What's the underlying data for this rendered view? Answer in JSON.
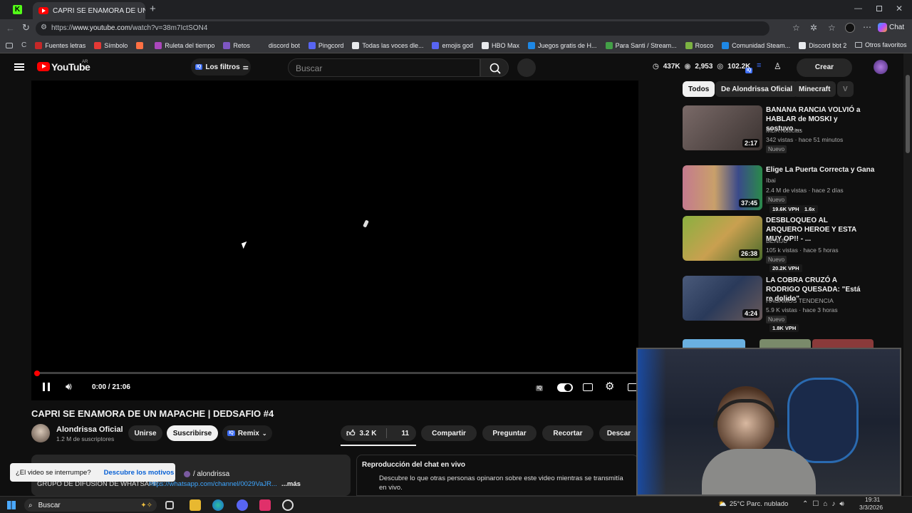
{
  "browser": {
    "tab_title": "CAPRI SE ENAMORA DE UN MAPACHE",
    "url_prefix": "https://",
    "url_host": "www.youtube.com",
    "url_path": "/watch?v=38m7IctSON4",
    "chat_label": "Chat",
    "bookmarks": [
      {
        "label": "Fuentes letras",
        "color": "#c62828"
      },
      {
        "label": "Símbolo",
        "color": "#e53935"
      },
      {
        "label": "",
        "color": "#ff7043"
      },
      {
        "label": "Ruleta del tiempo",
        "color": "#ab47bc"
      },
      {
        "label": "Retos",
        "color": "#7e57c2"
      },
      {
        "label": "discord bot",
        "color": "#35363a"
      },
      {
        "label": "Pingcord",
        "color": "#5865f2"
      },
      {
        "label": "Todas las voces dle...",
        "color": "#e8eaed"
      },
      {
        "label": "emojis god",
        "color": "#5865f2"
      },
      {
        "label": "HBO Max",
        "color": "#e8eaed"
      },
      {
        "label": "Juegos gratis de H...",
        "color": "#1e88e5"
      },
      {
        "label": "Para Santi / Stream...",
        "color": "#43a047"
      },
      {
        "label": "Rosco",
        "color": "#7cb342"
      },
      {
        "label": "Comunidad Steam...",
        "color": "#1e88e5"
      },
      {
        "label": "Discord bot 2",
        "color": "#e8eaed"
      }
    ],
    "other_favorites": "Otros favoritos"
  },
  "youtube": {
    "logo_text": "YouTube",
    "country": "AR",
    "filters_label": "Los filtros",
    "search_placeholder": "Buscar",
    "stats": [
      "437K",
      "2,953",
      "102.2K"
    ],
    "create_label": "Crear"
  },
  "player": {
    "time": "0:00 / 21:06",
    "progress": 0
  },
  "video": {
    "title": "CAPRI SE ENAMORA DE UN MAPACHE | DEDSAFIO #4",
    "channel": "Alondrissa Oficial",
    "subscribers": "1.2 M de suscriptores",
    "join": "Unirse",
    "subscribe": "Suscribirse",
    "remix": "Remix",
    "likes": "3.2 K",
    "dislikes": "11",
    "share": "Compartir",
    "ask": "Preguntar",
    "clip": "Recortar",
    "download": "Descar",
    "desc_handle": "/ alondrissa",
    "desc_line": "GRUPO DE DIFUSIÓN DE WHATSAPP :",
    "desc_link": "https://whatsapp.com/channel/0029VaJR...",
    "desc_more": "...más",
    "interrupt_q": "¿El video se interrumpe?",
    "interrupt_link": "Descubre los motivos",
    "chat_replay_title": "Reproducción del chat en vivo",
    "chat_replay_desc": "Descubre lo que otras personas opinaron sobre este video mientras se transmitía en vivo."
  },
  "sidebar": {
    "chips": [
      "Todos",
      "De Alondrissa Oficial",
      "Minecraft",
      "V"
    ],
    "recs": [
      {
        "title": "BANANA RANCIA VOLVIÓ a HABLAR de MOSKI y sostuvo ...",
        "channel": "MDA Noticias",
        "meta": "342 vistas · hace 51 minutos",
        "badge": "Nuevo",
        "duration": "2:17",
        "vph": "",
        "ratio": "",
        "thumb": "#5a4a48"
      },
      {
        "title": "Elige La Puerta Correcta y Gana",
        "channel": "Ibai",
        "meta": "2.4 M de vistas · hace 2 días",
        "badge": "Nuevo",
        "duration": "37:45",
        "vph": "19.6K VPH",
        "ratio": "1.6x",
        "thumb": "#b06a7a"
      },
      {
        "title": "DESBLOQUEO AL ARQUERO HEROE Y ESTA MUY OP!! - ...",
        "channel": "BENIJU",
        "meta": "105 k vistas · hace 5 horas",
        "badge": "Nuevo",
        "duration": "26:38",
        "vph": "20.2K VPH",
        "ratio": "",
        "thumb": "#6a8a3a"
      },
      {
        "title": "LA COBRA CRUZÓ A RODRIGO QUESADA: \"Está re dolido\"",
        "channel": "HAGAMOS TENDENCIA",
        "meta": "5.9 K vistas · hace 3 horas",
        "badge": "Nuevo",
        "duration": "4:24",
        "vph": "1.8K VPH",
        "ratio": "",
        "thumb": "#3a4a6a"
      }
    ]
  },
  "taskbar": {
    "search": "Buscar",
    "weather": "25°C  Parc. nublado",
    "time": "19:31",
    "date": "3/3/2026"
  }
}
